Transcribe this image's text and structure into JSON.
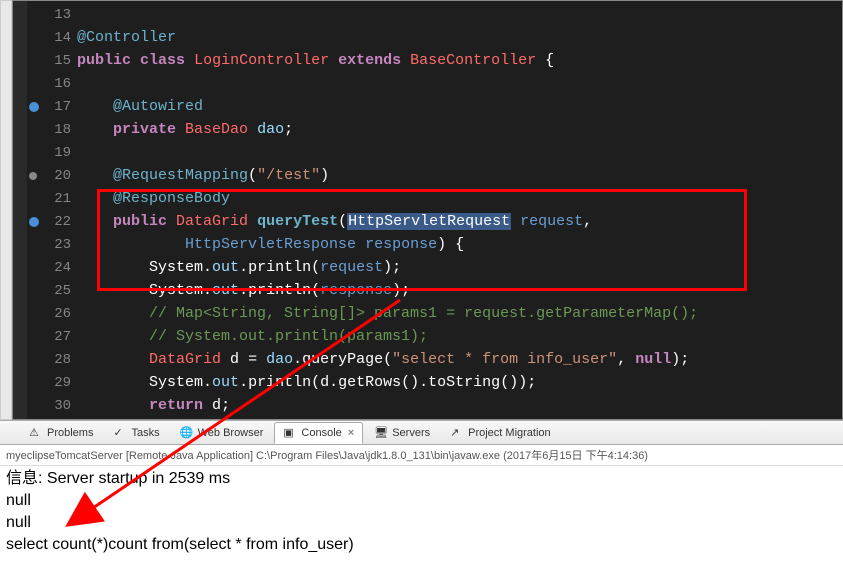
{
  "gutter": {
    "start": 13,
    "end": 30,
    "markers": {
      "17": "blue",
      "20": "gray",
      "22": "blue"
    }
  },
  "code": {
    "l13": {
      "indent": ""
    },
    "l14": {
      "anno": "@Controller"
    },
    "l15": {
      "kw1": "public",
      "kw2": "class",
      "type": "LoginController",
      "kw3": "extends",
      "base": "BaseController",
      "brace": " {"
    },
    "l16": {
      "blank": ""
    },
    "l17": {
      "anno": "@Autowired"
    },
    "l18": {
      "kw": "private",
      "type": "BaseDao",
      "name": "dao",
      "semi": ";"
    },
    "l19": {
      "blank": ""
    },
    "l20": {
      "anno": "@RequestMapping",
      "paren": "(",
      "str": "\"/test\"",
      "close": ")"
    },
    "l21": {
      "anno": "@ResponseBody"
    },
    "l22": {
      "kw": "public",
      "ret": "DataGrid",
      "method": "queryTest",
      "paren": "(",
      "ptype": "HttpServletRequest",
      "pname": "request",
      "comma": ","
    },
    "l23": {
      "ptype": "HttpServletResponse",
      "pname": "response",
      "close": ") {"
    },
    "l24": {
      "sys": "System",
      "dot1": ".",
      "out": "out",
      "dot2": ".",
      "fn": "println",
      "paren": "(",
      "arg": "request",
      "close": ");"
    },
    "l25": {
      "sys": "System",
      "dot1": ".",
      "out": "out",
      "dot2": ".",
      "fn": "println",
      "paren": "(",
      "arg": "response",
      "close": ");"
    },
    "l26": {
      "comment": "// Map<String, String[]> params1 = request.getParameterMap();"
    },
    "l27": {
      "comment": "// System.out.println(params1);"
    },
    "l28": {
      "type": "DataGrid",
      "var": "d",
      "eq": " = ",
      "obj": "dao",
      "dot": ".",
      "fn": "queryPage",
      "paren": "(",
      "str": "\"select * from info_user\"",
      "comma": ", ",
      "null": "null",
      "close": ");"
    },
    "l29": {
      "sys": "System",
      "dot1": ".",
      "out": "out",
      "dot2": ".",
      "fn": "println",
      "paren": "(",
      "arg": "d",
      "dot3": ".",
      "fn2": "getRows",
      "p2": "().",
      "fn3": "toString",
      "p3": "()",
      "close": ");"
    },
    "l30": {
      "kw": "return",
      "var": "d",
      "semi": ";"
    }
  },
  "tabs": {
    "problems": "Problems",
    "tasks": "Tasks",
    "webbrowser": "Web Browser",
    "console": "Console",
    "servers": "Servers",
    "migration": "Project Migration"
  },
  "console": {
    "header": "myeclipseTomcatServer [Remote Java Application] C:\\Program Files\\Java\\jdk1.8.0_131\\bin\\javaw.exe (2017年6月15日 下午4:14:36)",
    "l1": "信息: Server startup in 2539 ms",
    "l2": "null",
    "l3": "null",
    "l4": "select count(*)count from(select * from info_user)"
  }
}
